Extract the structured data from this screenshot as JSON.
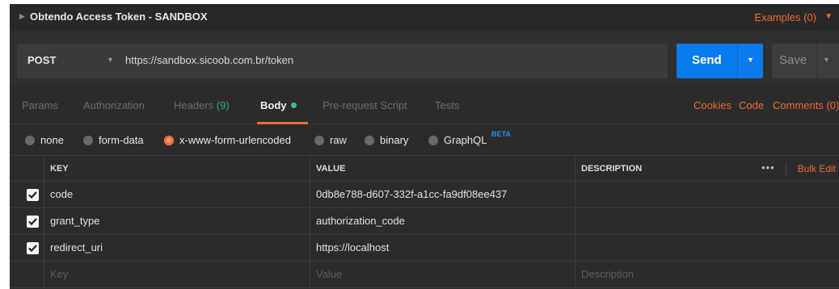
{
  "request": {
    "title": "Obtendo Access Token - SANDBOX",
    "examples_label": "Examples (0)",
    "method": "POST",
    "url": "https://sandbox.sicoob.com.br/token"
  },
  "actions": {
    "send_label": "Send",
    "save_label": "Save"
  },
  "tabs": [
    {
      "label": "Params"
    },
    {
      "label": "Authorization"
    },
    {
      "label": "Headers",
      "count": "(9)"
    },
    {
      "label": "Body"
    },
    {
      "label": "Pre-request Script"
    },
    {
      "label": "Tests"
    }
  ],
  "tab_links": [
    "Cookies",
    "Code",
    "Comments (0)"
  ],
  "body_types": {
    "options": [
      "none",
      "form-data",
      "x-www-form-urlencoded",
      "raw",
      "binary",
      "GraphQL"
    ],
    "selected": "x-www-form-urlencoded",
    "graphql_badge": "BETA"
  },
  "table": {
    "headers": {
      "key": "KEY",
      "value": "VALUE",
      "description": "DESCRIPTION"
    },
    "more_label": "•••",
    "bulk_edit_label": "Bulk Edit",
    "rows": [
      {
        "key": "code",
        "value": "0db8e788-d607-332f-a1cc-fa9df08ee437",
        "description": "",
        "checked": true
      },
      {
        "key": "grant_type",
        "value": "authorization_code",
        "description": "",
        "checked": true
      },
      {
        "key": "redirect_uri",
        "value": "https://localhost",
        "description": "",
        "checked": true
      }
    ],
    "placeholders": {
      "key": "Key",
      "value": "Value",
      "description": "Description"
    }
  },
  "colors": {
    "accent": "#f26b3a",
    "send_button": "#097bed",
    "body_dot": "#3ec280",
    "background": "#2b2b2b"
  },
  "icons": {
    "title_caret": "caret-right-icon",
    "dropdown": "chevron-down-icon",
    "checkbox": "checkmark-icon"
  }
}
